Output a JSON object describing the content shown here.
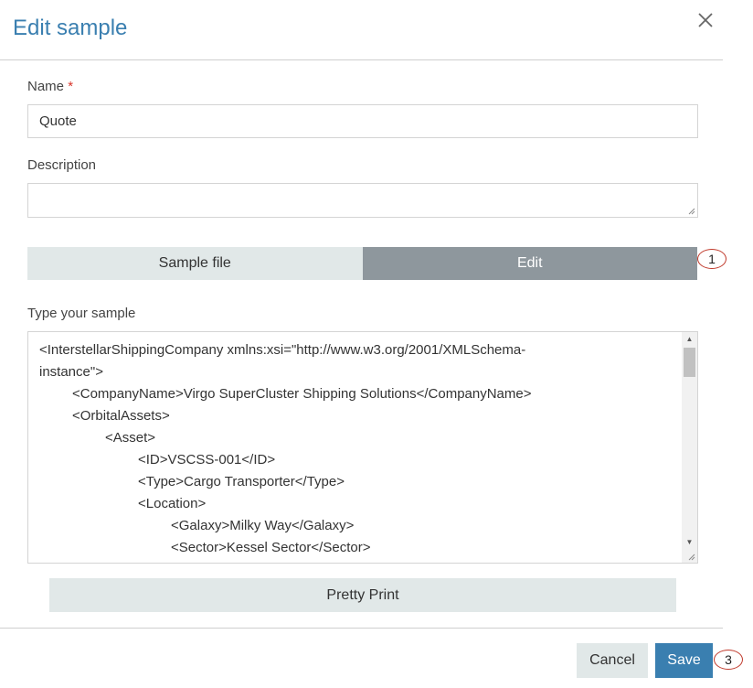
{
  "dialog": {
    "title": "Edit sample",
    "close_icon": "close-icon"
  },
  "form": {
    "name_label": "Name",
    "required_marker": "*",
    "name_value": "Quote",
    "description_label": "Description",
    "description_value": ""
  },
  "tabs": [
    {
      "label": "Sample file",
      "active": false
    },
    {
      "label": "Edit",
      "active": true
    }
  ],
  "sample": {
    "label": "Type your sample",
    "lines": [
      {
        "indent": 0,
        "text": "<InterstellarShippingCompany xmlns:xsi=\"http://www.w3.org/2001/XMLSchema-"
      },
      {
        "indent": 0,
        "text": "instance\">"
      },
      {
        "indent": 1,
        "text": "<CompanyName>Virgo SuperCluster Shipping Solutions</CompanyName>"
      },
      {
        "indent": 1,
        "text": "<OrbitalAssets>"
      },
      {
        "indent": 2,
        "text": "<Asset>"
      },
      {
        "indent": 3,
        "text": "<ID>VSCSS-001</ID>"
      },
      {
        "indent": 3,
        "text": "<Type>Cargo Transporter</Type>"
      },
      {
        "indent": 3,
        "text": "<Location>"
      },
      {
        "indent": 4,
        "text": "<Galaxy>Milky Way</Galaxy>"
      },
      {
        "indent": 4,
        "text": "<Sector>Kessel Sector</Sector>"
      }
    ]
  },
  "buttons": {
    "pretty_print": "Pretty Print",
    "cancel": "Cancel",
    "save": "Save"
  },
  "annotations": {
    "badge_1": "1",
    "badge_3": "3",
    "badge_color": "#c0392b"
  },
  "colors": {
    "title": "#3a7fb0",
    "primary": "#3a7fb0",
    "tab_active": "#8e979d",
    "tab_inactive": "#e1e8e8"
  }
}
